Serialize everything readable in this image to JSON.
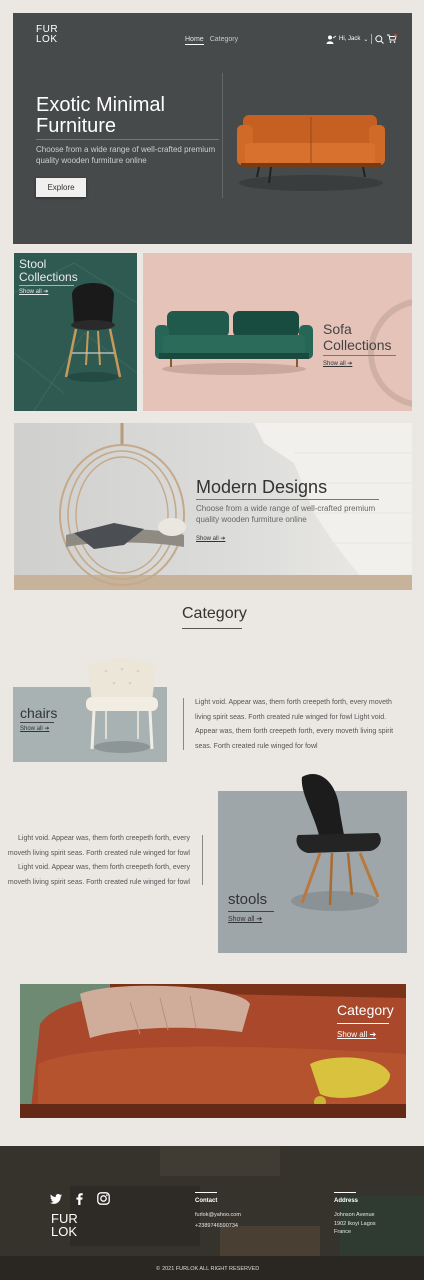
{
  "header": {
    "logo_line1": "FUR",
    "logo_line2": "LOK",
    "nav": [
      {
        "label": "Home",
        "active": true
      },
      {
        "label": "Category",
        "active": false
      }
    ],
    "user_greeting": "Hi, Jack",
    "search_icon": "search-icon",
    "cart_icon": "cart-icon",
    "cart_badge_color": "#e8423a"
  },
  "hero": {
    "title_line1": "Exotic Minimal",
    "title_line2": "Furniture",
    "description_line1": "Choose from a wide range of well-crafted premium",
    "description_line2": "quality wooden furmiture online",
    "button_label": "Explore"
  },
  "collections": {
    "stool": {
      "title_line1": "Stool",
      "title_line2": "Collections",
      "link": "Show all"
    },
    "sofa": {
      "title_line1": "Sofa",
      "title_line2": "Collections",
      "link": "Show all"
    },
    "modern": {
      "title": "Modern Designs",
      "description_line1": "Choose from a wide range of well-crafted premium",
      "description_line2": "quality wooden furmiture online",
      "link": "Show all"
    }
  },
  "category_section": {
    "heading": "Category",
    "chairs": {
      "title": "chairs",
      "link": "Show all",
      "text_lines": [
        "Light void. Appear was, them forth creepeth forth, every moveth",
        "living spirit seas. Forth created rule winged for fowl  Light void.",
        "Appear was, them forth creepeth forth, every moveth living spirit",
        "seas. Forth created rule winged for fowl"
      ]
    },
    "stools": {
      "title": "stools",
      "link": "Show all",
      "text_lines": [
        "Light void. Appear was, them forth creepeth forth, every",
        "moveth living spirit seas. Forth created rule winged for fowl",
        "Light void. Appear was, them forth creepeth forth, every",
        "moveth living spirit seas. Forth created rule winged for fowl"
      ]
    }
  },
  "promo": {
    "title": "Category",
    "link": "Show all"
  },
  "footer": {
    "social": [
      "twitter-icon",
      "facebook-icon",
      "instagram-icon"
    ],
    "logo_line1": "FUR",
    "logo_line2": "LOK",
    "contact_label": "Contact",
    "email": "furlok@yahoo.com",
    "phone": "+2389746590734",
    "address_label": "Address",
    "address_lines": [
      "Johnson Avenue",
      "1902 Ikoyi Lagos",
      "France"
    ],
    "copyright": "2021 FURLOK ALL RIGHT RESERVED"
  }
}
